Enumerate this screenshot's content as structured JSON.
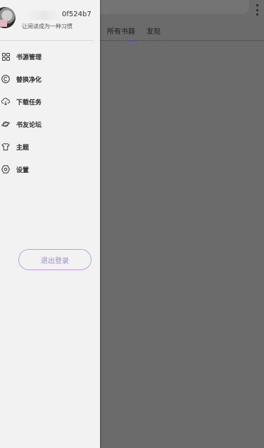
{
  "app": {
    "search_bar": "",
    "tabs": [
      {
        "label": "所有书籍",
        "active": true
      },
      {
        "label": "发现",
        "active": false
      }
    ]
  },
  "drawer": {
    "user": {
      "id_text": "0f524b7",
      "motto": "让阅读成为一种习惯"
    },
    "menu": [
      {
        "label": "书源管理",
        "icon": "grid-icon"
      },
      {
        "label": "替换净化",
        "icon": "copyright-icon"
      },
      {
        "label": "下载任务",
        "icon": "cloud-download-icon"
      },
      {
        "label": "书友论坛",
        "icon": "planet-icon"
      },
      {
        "label": "主题",
        "icon": "tshirt-icon"
      },
      {
        "label": "设置",
        "icon": "hexagon-settings-icon"
      }
    ],
    "logout_label": "退出登录"
  },
  "colors": {
    "accent": "#a08cc6",
    "tab_indicator": "#4e5bb0",
    "drawer_bg": "#f2f2f2",
    "scrim": "#6b6b6b"
  }
}
